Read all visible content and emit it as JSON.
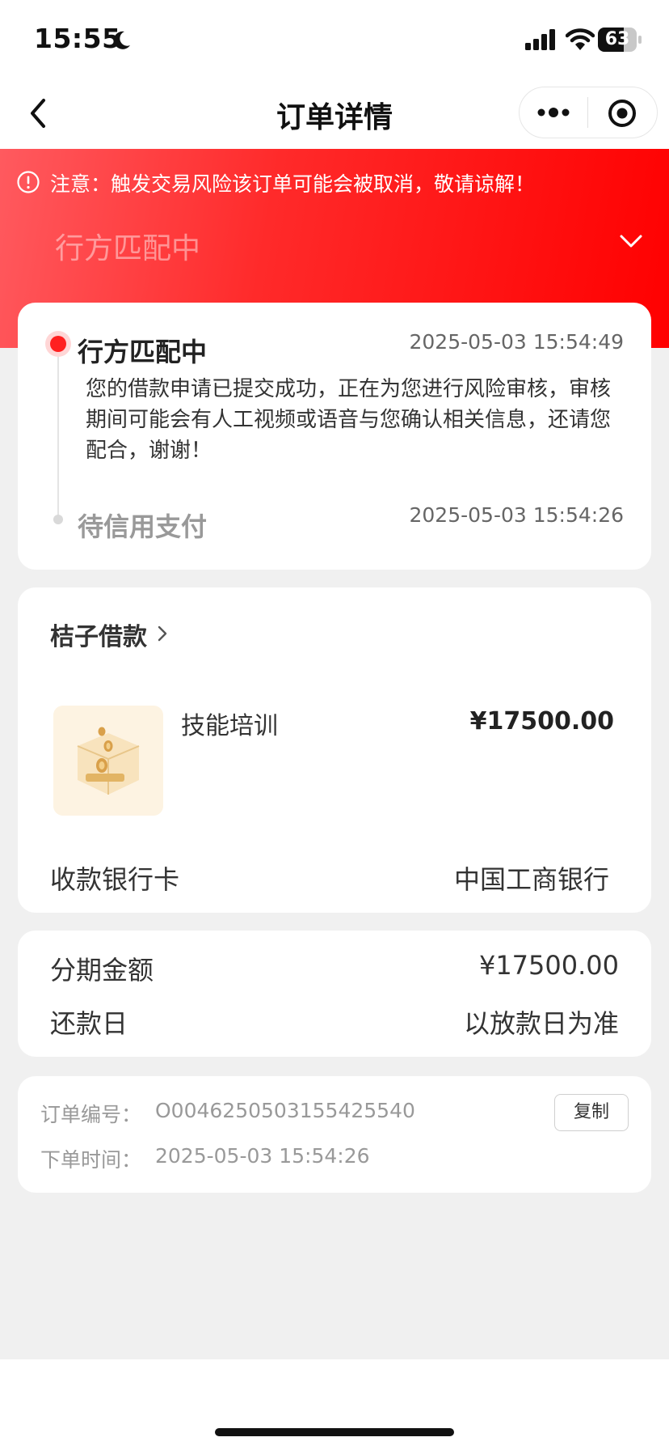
{
  "status_bar": {
    "time": "15:55",
    "battery": "63"
  },
  "nav": {
    "title": "订单详情"
  },
  "banner": {
    "warning": "注意：触发交易风险该订单可能会被取消，敬请谅解！",
    "stage": "行方匹配中"
  },
  "progress": {
    "steps": [
      {
        "title": "行方匹配中",
        "time": "2025-05-03 15:54:49",
        "desc": "您的借款申请已提交成功，正在为您进行风险审核，审核期间可能会有人工视频或语音与您确认相关信息，还请您配合，谢谢！"
      },
      {
        "title": "待信用支付",
        "time": "2025-05-03 15:54:26"
      }
    ]
  },
  "product": {
    "merchant": "桔子借款",
    "name": "技能培训",
    "price": "¥17500.00",
    "bank_label": "收款银行卡",
    "bank_value": "中国工商银行"
  },
  "amount": {
    "amount_label": "分期金额",
    "amount_value": "¥17500.00",
    "repay_label": "还款日",
    "repay_value": "以放款日为准"
  },
  "order": {
    "no_label": "订单编号：",
    "no_value": "O0046250503155425540",
    "copy_label": "复制",
    "time_label": "下单时间：",
    "time_value": "2025-05-03 15:54:26"
  },
  "colors": {
    "accent_red": "#ff2020",
    "banner_start": "#ff5a5f",
    "banner_end": "#ff0000"
  },
  "icons": [
    "moon-icon",
    "signal-icon",
    "wifi-icon",
    "battery-icon",
    "back-icon",
    "more-icon",
    "target-icon",
    "warning-icon",
    "chevron-down-icon",
    "chevron-right-icon",
    "coin-box-icon"
  ]
}
